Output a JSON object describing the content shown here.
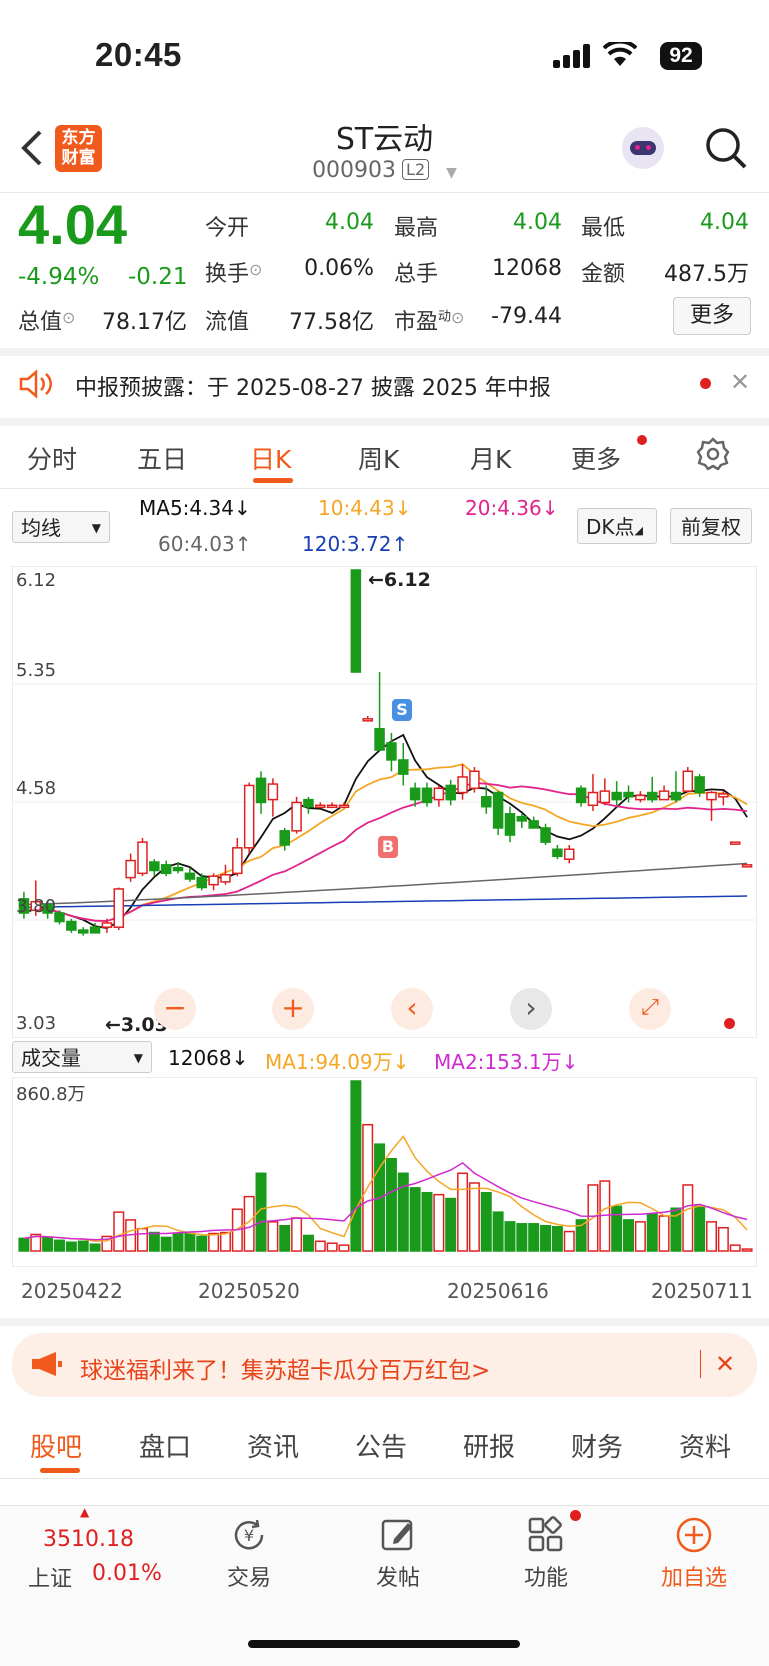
{
  "status": {
    "time": "20:45",
    "battery": "92"
  },
  "header": {
    "title": "ST云动",
    "code": "000903",
    "level": "L2",
    "logo_line1": "东方",
    "logo_line2": "财富"
  },
  "quote": {
    "price": "4.04",
    "change_pct": "-4.94%",
    "change": "-0.21",
    "fields": [
      {
        "label": "今开",
        "value": "4.04",
        "color": "green"
      },
      {
        "label": "最高",
        "value": "4.04",
        "color": "green"
      },
      {
        "label": "最低",
        "value": "4.04",
        "color": "green"
      },
      {
        "label": "换手",
        "value": "0.06%",
        "color": "black"
      },
      {
        "label": "总手",
        "value": "12068",
        "color": "black"
      },
      {
        "label": "金额",
        "value": "487.5万",
        "color": "black"
      },
      {
        "label": "总值",
        "value": "78.17亿",
        "color": "black"
      },
      {
        "label": "流值",
        "value": "77.58亿",
        "color": "black"
      },
      {
        "label": "市盈",
        "value": "-79.44",
        "color": "black",
        "sup": "动"
      }
    ],
    "more_label": "更多"
  },
  "notice": {
    "text": "中报预披露：于 2025-08-27 披露 2025 年中报"
  },
  "tabs": [
    "分时",
    "五日",
    "日K",
    "周K",
    "月K",
    "更多"
  ],
  "active_tab": "日K",
  "ma_bar": {
    "selector": "均线",
    "ma5": "MA5:4.34",
    "ma10": "10:4.43",
    "ma20": "20:4.36",
    "ma60": "60:4.03",
    "ma120": "120:3.72",
    "dk_button": "DK点",
    "adjust_button": "前复权"
  },
  "kline": {
    "y_labels": [
      "6.12",
      "5.35",
      "4.58",
      "3.80",
      "3.03"
    ],
    "high_label": "←6.12",
    "low_label": "←3.03",
    "buy_marker": "B",
    "sell_marker": "S"
  },
  "volume": {
    "selector": "成交量",
    "vol": "12068",
    "ma1": "MA1:94.09万",
    "ma2": "MA2:153.1万",
    "max_label": "860.8万",
    "dates": [
      "20250422",
      "20250520",
      "20250616",
      "20250711"
    ]
  },
  "chart_data": {
    "type": "candlestick",
    "ylim": [
      3.03,
      6.12
    ],
    "candles": [
      {
        "o": 3.8,
        "c": 3.7,
        "h": 3.85,
        "l": 3.66,
        "v": 13
      },
      {
        "o": 3.72,
        "c": 3.78,
        "h": 3.93,
        "l": 3.68,
        "v": 17
      },
      {
        "o": 3.76,
        "c": 3.7,
        "h": 3.78,
        "l": 3.66,
        "v": 14
      },
      {
        "o": 3.7,
        "c": 3.64,
        "h": 3.72,
        "l": 3.62,
        "v": 11
      },
      {
        "o": 3.64,
        "c": 3.58,
        "h": 3.66,
        "l": 3.56,
        "v": 9
      },
      {
        "o": 3.58,
        "c": 3.56,
        "h": 3.6,
        "l": 3.54,
        "v": 10
      },
      {
        "o": 3.6,
        "c": 3.56,
        "h": 3.63,
        "l": 3.56,
        "v": 7
      },
      {
        "o": 3.6,
        "c": 3.63,
        "h": 3.66,
        "l": 3.56,
        "v": 15
      },
      {
        "o": 3.6,
        "c": 3.87,
        "h": 3.88,
        "l": 3.58,
        "v": 40
      },
      {
        "o": 3.95,
        "c": 4.07,
        "h": 4.12,
        "l": 3.92,
        "v": 32
      },
      {
        "o": 3.98,
        "c": 4.2,
        "h": 4.23,
        "l": 3.96,
        "v": 23
      },
      {
        "o": 4.06,
        "c": 4.0,
        "h": 4.08,
        "l": 3.96,
        "v": 19
      },
      {
        "o": 4.04,
        "c": 3.98,
        "h": 4.07,
        "l": 3.96,
        "v": 14
      },
      {
        "o": 4.02,
        "c": 4.0,
        "h": 4.06,
        "l": 3.98,
        "v": 18
      },
      {
        "o": 3.98,
        "c": 3.94,
        "h": 4.02,
        "l": 3.92,
        "v": 18
      },
      {
        "o": 3.95,
        "c": 3.88,
        "h": 3.98,
        "l": 3.86,
        "v": 15
      },
      {
        "o": 3.9,
        "c": 3.96,
        "h": 3.98,
        "l": 3.86,
        "v": 18
      },
      {
        "o": 3.92,
        "c": 3.97,
        "h": 4.04,
        "l": 3.9,
        "v": 19
      },
      {
        "o": 3.98,
        "c": 4.16,
        "h": 4.23,
        "l": 3.96,
        "v": 43
      },
      {
        "o": 4.16,
        "c": 4.6,
        "h": 4.62,
        "l": 4.12,
        "v": 56
      },
      {
        "o": 4.65,
        "c": 4.48,
        "h": 4.7,
        "l": 4.4,
        "v": 80
      },
      {
        "o": 4.5,
        "c": 4.61,
        "h": 4.65,
        "l": 4.38,
        "v": 30
      },
      {
        "o": 4.28,
        "c": 4.18,
        "h": 4.3,
        "l": 4.14,
        "v": 26
      },
      {
        "o": 4.28,
        "c": 4.48,
        "h": 4.52,
        "l": 4.26,
        "v": 34
      },
      {
        "o": 4.5,
        "c": 4.45,
        "h": 4.52,
        "l": 4.4,
        "v": 16
      },
      {
        "o": 4.45,
        "c": 4.46,
        "h": 4.48,
        "l": 4.44,
        "v": 10
      },
      {
        "o": 4.46,
        "c": 4.46,
        "h": 4.48,
        "l": 4.44,
        "v": 8
      },
      {
        "o": 4.46,
        "c": 4.46,
        "h": 4.48,
        "l": 4.44,
        "v": 6
      },
      {
        "o": 6.12,
        "c": 5.4,
        "h": 6.12,
        "l": 5.4,
        "v": 175
      },
      {
        "o": 5.07,
        "c": 5.07,
        "h": 5.09,
        "l": 5.05,
        "v": 130
      },
      {
        "o": 5.0,
        "c": 4.85,
        "h": 5.4,
        "l": 4.85,
        "v": 110
      },
      {
        "o": 4.9,
        "c": 4.78,
        "h": 4.97,
        "l": 4.7,
        "v": 95
      },
      {
        "o": 4.78,
        "c": 4.68,
        "h": 4.9,
        "l": 4.6,
        "v": 80
      },
      {
        "o": 4.58,
        "c": 4.5,
        "h": 4.62,
        "l": 4.45,
        "v": 65
      },
      {
        "o": 4.58,
        "c": 4.48,
        "h": 4.62,
        "l": 4.45,
        "v": 60
      },
      {
        "o": 4.5,
        "c": 4.58,
        "h": 4.6,
        "l": 4.45,
        "v": 58
      },
      {
        "o": 4.6,
        "c": 4.5,
        "h": 4.64,
        "l": 4.46,
        "v": 54
      },
      {
        "o": 4.55,
        "c": 4.66,
        "h": 4.75,
        "l": 4.5,
        "v": 80
      },
      {
        "o": 4.58,
        "c": 4.7,
        "h": 4.73,
        "l": 4.55,
        "v": 70
      },
      {
        "o": 4.52,
        "c": 4.45,
        "h": 4.6,
        "l": 4.4,
        "v": 60
      },
      {
        "o": 4.55,
        "c": 4.3,
        "h": 4.56,
        "l": 4.25,
        "v": 40
      },
      {
        "o": 4.4,
        "c": 4.25,
        "h": 4.45,
        "l": 4.2,
        "v": 30
      },
      {
        "o": 4.38,
        "c": 4.35,
        "h": 4.4,
        "l": 4.3,
        "v": 28
      },
      {
        "o": 4.35,
        "c": 4.3,
        "h": 4.38,
        "l": 4.3,
        "v": 28
      },
      {
        "o": 4.3,
        "c": 4.2,
        "h": 4.33,
        "l": 4.18,
        "v": 26
      },
      {
        "o": 4.15,
        "c": 4.1,
        "h": 4.18,
        "l": 4.08,
        "v": 25
      },
      {
        "o": 4.08,
        "c": 4.15,
        "h": 4.18,
        "l": 4.05,
        "v": 20
      },
      {
        "o": 4.58,
        "c": 4.48,
        "h": 4.6,
        "l": 4.45,
        "v": 32
      },
      {
        "o": 4.46,
        "c": 4.55,
        "h": 4.68,
        "l": 4.42,
        "v": 68
      },
      {
        "o": 4.48,
        "c": 4.56,
        "h": 4.65,
        "l": 4.46,
        "v": 72
      },
      {
        "o": 4.55,
        "c": 4.5,
        "h": 4.63,
        "l": 4.46,
        "v": 46
      },
      {
        "o": 4.55,
        "c": 4.52,
        "h": 4.6,
        "l": 4.48,
        "v": 32
      },
      {
        "o": 4.5,
        "c": 4.53,
        "h": 4.56,
        "l": 4.48,
        "v": 30
      },
      {
        "o": 4.55,
        "c": 4.5,
        "h": 4.66,
        "l": 4.48,
        "v": 38
      },
      {
        "o": 4.5,
        "c": 4.56,
        "h": 4.6,
        "l": 4.5,
        "v": 36
      },
      {
        "o": 4.55,
        "c": 4.5,
        "h": 4.7,
        "l": 4.48,
        "v": 44
      },
      {
        "o": 4.56,
        "c": 4.7,
        "h": 4.73,
        "l": 4.55,
        "v": 68
      },
      {
        "o": 4.66,
        "c": 4.55,
        "h": 4.68,
        "l": 4.52,
        "v": 46
      },
      {
        "o": 4.5,
        "c": 4.55,
        "h": 4.56,
        "l": 4.35,
        "v": 30
      },
      {
        "o": 4.52,
        "c": 4.54,
        "h": 4.56,
        "l": 4.46,
        "v": 24
      },
      {
        "o": 4.2,
        "c": 4.2,
        "h": 4.2,
        "l": 4.2,
        "v": 6
      },
      {
        "o": 4.04,
        "c": 4.04,
        "h": 4.04,
        "l": 4.04,
        "v": 2
      }
    ]
  },
  "promo": {
    "text": "球迷福利来了！集苏超卡瓜分百万红包>"
  },
  "bottom_tabs": [
    "股吧",
    "盘口",
    "资讯",
    "公告",
    "研报",
    "财务",
    "资料"
  ],
  "footer": {
    "index_value": "3510.18",
    "index_name": "上证",
    "index_change": "0.01%",
    "items": [
      "交易",
      "发帖",
      "功能",
      "加自选"
    ]
  },
  "colors": {
    "accent": "#f05a1c",
    "up": "#e02020",
    "down": "#1a9a1a",
    "ma5": "#111111",
    "ma10": "#f5a623",
    "ma20": "#e0248c",
    "ma60": "#666666",
    "ma120": "#1a3fb5"
  }
}
